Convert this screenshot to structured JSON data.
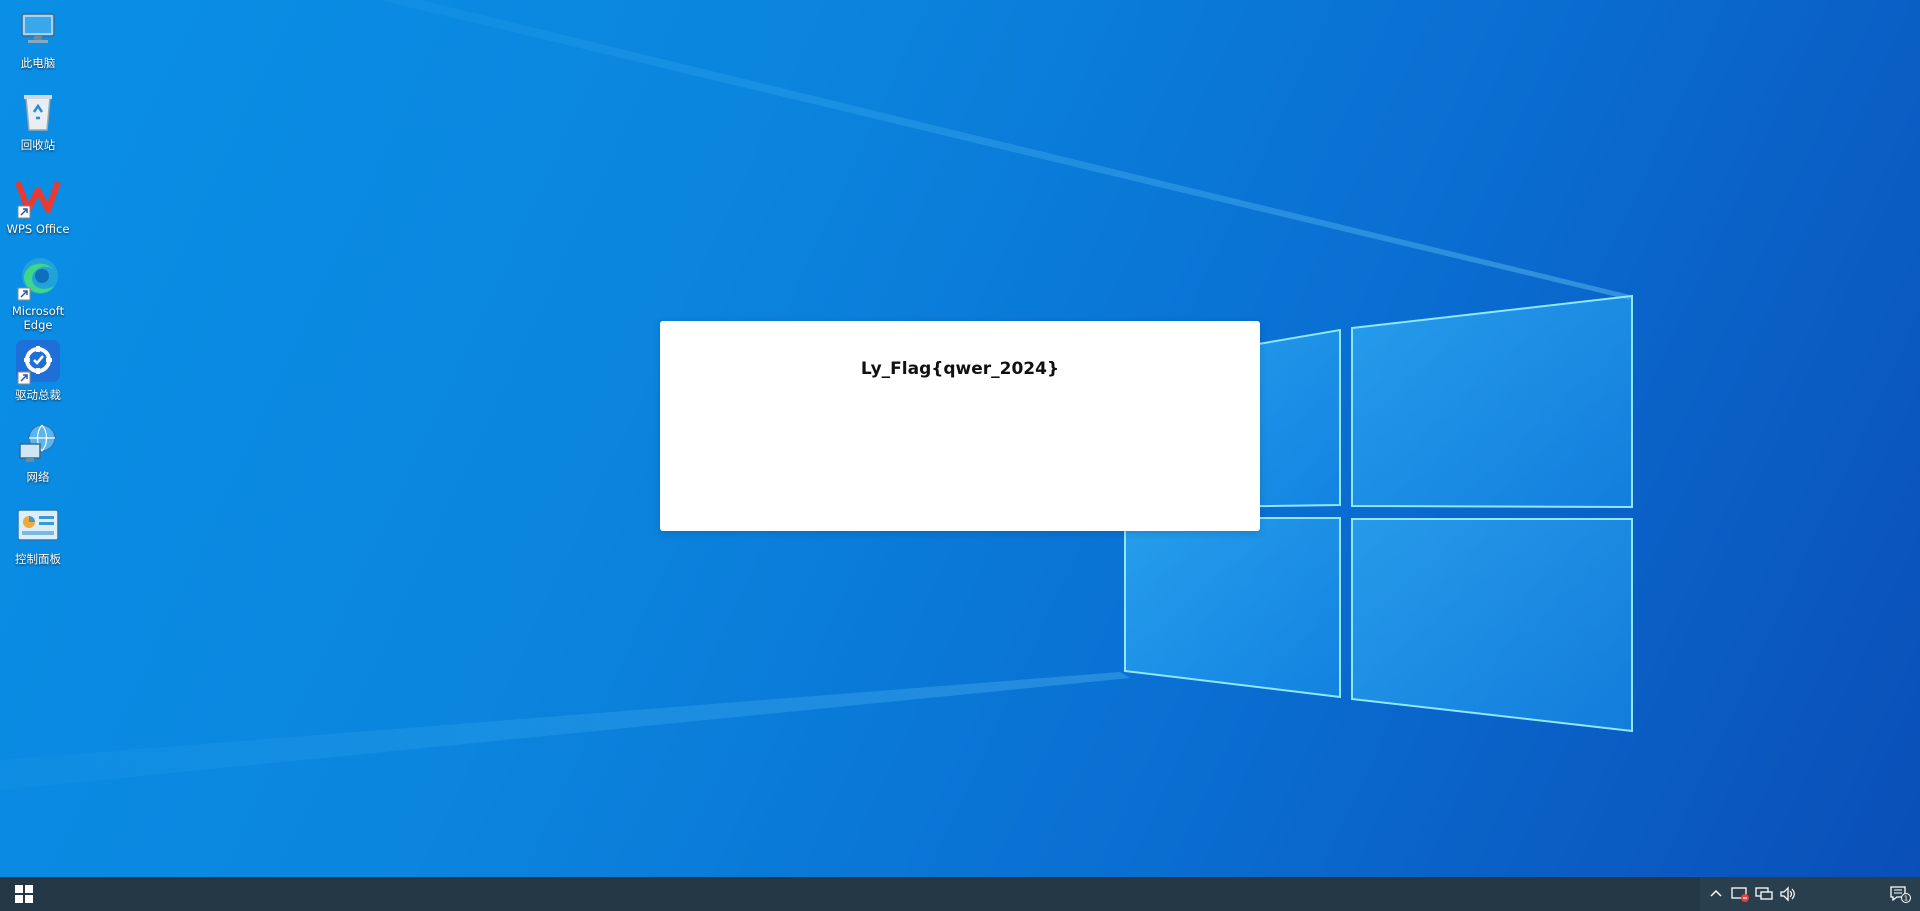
{
  "desktop": {
    "icons": [
      {
        "label": "此电脑",
        "icon": "computer-icon"
      },
      {
        "label": "回收站",
        "icon": "recycle-bin-icon"
      },
      {
        "label": "WPS Office",
        "icon": "wps-office-icon"
      },
      {
        "label": "Microsoft Edge",
        "icon": "edge-icon"
      },
      {
        "label": "驱动总裁",
        "icon": "driver-tool-icon"
      },
      {
        "label": "网络",
        "icon": "network-icon"
      },
      {
        "label": "控制面板",
        "icon": "control-panel-icon"
      }
    ]
  },
  "dialog": {
    "text": "Ly_Flag{qwer_2024}"
  },
  "taskbar": {
    "start_icon": "windows-logo-icon",
    "tray": [
      "chevron-up-icon",
      "security-icon",
      "network-wired-icon",
      "volume-icon",
      "notification-icon"
    ],
    "notification_count": "1"
  },
  "colors": {
    "desktop_blue": "#0a8fe6",
    "taskbar": "#233745",
    "dialog_bg": "#ffffff"
  }
}
